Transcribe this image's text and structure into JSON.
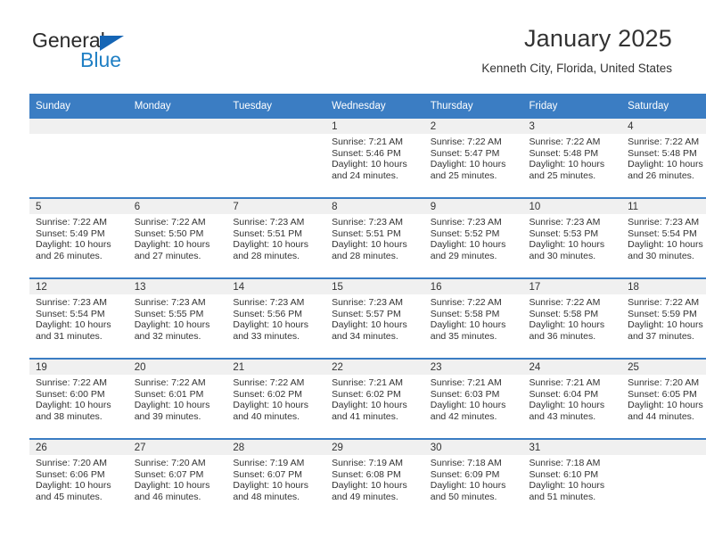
{
  "brand": {
    "name_top": "General",
    "name_bottom": "Blue",
    "triangle_icon": "triangle-icon",
    "accent_color": "#1f7fc4",
    "logo_blue": "#1565b5"
  },
  "header": {
    "title": "January 2025",
    "subtitle": "Kenneth City, Florida, United States"
  },
  "calendar": {
    "header_color": "#3b7dc3",
    "daynum_band_color": "#f0f0f0",
    "weekdays": [
      "Sunday",
      "Monday",
      "Tuesday",
      "Wednesday",
      "Thursday",
      "Friday",
      "Saturday"
    ],
    "labels": {
      "sunrise_prefix": "Sunrise:",
      "sunset_prefix": "Sunset:",
      "daylight_prefix": "Daylight:"
    },
    "weeks": [
      [
        {
          "day": "",
          "sunrise": "",
          "sunset": "",
          "daylight": ""
        },
        {
          "day": "",
          "sunrise": "",
          "sunset": "",
          "daylight": ""
        },
        {
          "day": "",
          "sunrise": "",
          "sunset": "",
          "daylight": ""
        },
        {
          "day": "1",
          "sunrise": "Sunrise: 7:21 AM",
          "sunset": "Sunset: 5:46 PM",
          "daylight": "Daylight: 10 hours and 24 minutes."
        },
        {
          "day": "2",
          "sunrise": "Sunrise: 7:22 AM",
          "sunset": "Sunset: 5:47 PM",
          "daylight": "Daylight: 10 hours and 25 minutes."
        },
        {
          "day": "3",
          "sunrise": "Sunrise: 7:22 AM",
          "sunset": "Sunset: 5:48 PM",
          "daylight": "Daylight: 10 hours and 25 minutes."
        },
        {
          "day": "4",
          "sunrise": "Sunrise: 7:22 AM",
          "sunset": "Sunset: 5:48 PM",
          "daylight": "Daylight: 10 hours and 26 minutes."
        }
      ],
      [
        {
          "day": "5",
          "sunrise": "Sunrise: 7:22 AM",
          "sunset": "Sunset: 5:49 PM",
          "daylight": "Daylight: 10 hours and 26 minutes."
        },
        {
          "day": "6",
          "sunrise": "Sunrise: 7:22 AM",
          "sunset": "Sunset: 5:50 PM",
          "daylight": "Daylight: 10 hours and 27 minutes."
        },
        {
          "day": "7",
          "sunrise": "Sunrise: 7:23 AM",
          "sunset": "Sunset: 5:51 PM",
          "daylight": "Daylight: 10 hours and 28 minutes."
        },
        {
          "day": "8",
          "sunrise": "Sunrise: 7:23 AM",
          "sunset": "Sunset: 5:51 PM",
          "daylight": "Daylight: 10 hours and 28 minutes."
        },
        {
          "day": "9",
          "sunrise": "Sunrise: 7:23 AM",
          "sunset": "Sunset: 5:52 PM",
          "daylight": "Daylight: 10 hours and 29 minutes."
        },
        {
          "day": "10",
          "sunrise": "Sunrise: 7:23 AM",
          "sunset": "Sunset: 5:53 PM",
          "daylight": "Daylight: 10 hours and 30 minutes."
        },
        {
          "day": "11",
          "sunrise": "Sunrise: 7:23 AM",
          "sunset": "Sunset: 5:54 PM",
          "daylight": "Daylight: 10 hours and 30 minutes."
        }
      ],
      [
        {
          "day": "12",
          "sunrise": "Sunrise: 7:23 AM",
          "sunset": "Sunset: 5:54 PM",
          "daylight": "Daylight: 10 hours and 31 minutes."
        },
        {
          "day": "13",
          "sunrise": "Sunrise: 7:23 AM",
          "sunset": "Sunset: 5:55 PM",
          "daylight": "Daylight: 10 hours and 32 minutes."
        },
        {
          "day": "14",
          "sunrise": "Sunrise: 7:23 AM",
          "sunset": "Sunset: 5:56 PM",
          "daylight": "Daylight: 10 hours and 33 minutes."
        },
        {
          "day": "15",
          "sunrise": "Sunrise: 7:23 AM",
          "sunset": "Sunset: 5:57 PM",
          "daylight": "Daylight: 10 hours and 34 minutes."
        },
        {
          "day": "16",
          "sunrise": "Sunrise: 7:22 AM",
          "sunset": "Sunset: 5:58 PM",
          "daylight": "Daylight: 10 hours and 35 minutes."
        },
        {
          "day": "17",
          "sunrise": "Sunrise: 7:22 AM",
          "sunset": "Sunset: 5:58 PM",
          "daylight": "Daylight: 10 hours and 36 minutes."
        },
        {
          "day": "18",
          "sunrise": "Sunrise: 7:22 AM",
          "sunset": "Sunset: 5:59 PM",
          "daylight": "Daylight: 10 hours and 37 minutes."
        }
      ],
      [
        {
          "day": "19",
          "sunrise": "Sunrise: 7:22 AM",
          "sunset": "Sunset: 6:00 PM",
          "daylight": "Daylight: 10 hours and 38 minutes."
        },
        {
          "day": "20",
          "sunrise": "Sunrise: 7:22 AM",
          "sunset": "Sunset: 6:01 PM",
          "daylight": "Daylight: 10 hours and 39 minutes."
        },
        {
          "day": "21",
          "sunrise": "Sunrise: 7:22 AM",
          "sunset": "Sunset: 6:02 PM",
          "daylight": "Daylight: 10 hours and 40 minutes."
        },
        {
          "day": "22",
          "sunrise": "Sunrise: 7:21 AM",
          "sunset": "Sunset: 6:02 PM",
          "daylight": "Daylight: 10 hours and 41 minutes."
        },
        {
          "day": "23",
          "sunrise": "Sunrise: 7:21 AM",
          "sunset": "Sunset: 6:03 PM",
          "daylight": "Daylight: 10 hours and 42 minutes."
        },
        {
          "day": "24",
          "sunrise": "Sunrise: 7:21 AM",
          "sunset": "Sunset: 6:04 PM",
          "daylight": "Daylight: 10 hours and 43 minutes."
        },
        {
          "day": "25",
          "sunrise": "Sunrise: 7:20 AM",
          "sunset": "Sunset: 6:05 PM",
          "daylight": "Daylight: 10 hours and 44 minutes."
        }
      ],
      [
        {
          "day": "26",
          "sunrise": "Sunrise: 7:20 AM",
          "sunset": "Sunset: 6:06 PM",
          "daylight": "Daylight: 10 hours and 45 minutes."
        },
        {
          "day": "27",
          "sunrise": "Sunrise: 7:20 AM",
          "sunset": "Sunset: 6:07 PM",
          "daylight": "Daylight: 10 hours and 46 minutes."
        },
        {
          "day": "28",
          "sunrise": "Sunrise: 7:19 AM",
          "sunset": "Sunset: 6:07 PM",
          "daylight": "Daylight: 10 hours and 48 minutes."
        },
        {
          "day": "29",
          "sunrise": "Sunrise: 7:19 AM",
          "sunset": "Sunset: 6:08 PM",
          "daylight": "Daylight: 10 hours and 49 minutes."
        },
        {
          "day": "30",
          "sunrise": "Sunrise: 7:18 AM",
          "sunset": "Sunset: 6:09 PM",
          "daylight": "Daylight: 10 hours and 50 minutes."
        },
        {
          "day": "31",
          "sunrise": "Sunrise: 7:18 AM",
          "sunset": "Sunset: 6:10 PM",
          "daylight": "Daylight: 10 hours and 51 minutes."
        },
        {
          "day": "",
          "sunrise": "",
          "sunset": "",
          "daylight": ""
        }
      ]
    ]
  }
}
